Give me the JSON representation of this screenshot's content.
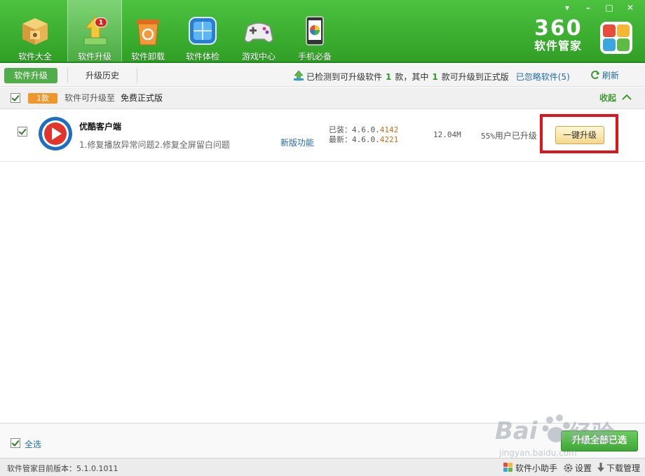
{
  "window": {
    "min": "▾",
    "restore": "–",
    "maximize": "□",
    "close": "✕"
  },
  "nav": [
    {
      "label": "软件大全",
      "icon": "box-icon"
    },
    {
      "label": "软件升级",
      "icon": "upgrade-arrow-icon",
      "badge": "1"
    },
    {
      "label": "软件卸载",
      "icon": "recycle-bin-icon"
    },
    {
      "label": "软件体检",
      "icon": "checkup-icon"
    },
    {
      "label": "游戏中心",
      "icon": "gamepad-icon"
    },
    {
      "label": "手机必备",
      "icon": "phone-icon"
    }
  ],
  "brand": {
    "name": "360",
    "sub": "软件管家"
  },
  "subbar": {
    "tab_active": "软件升级",
    "tab_history": "升级历史",
    "info_prefix": "已检测到可升级软件",
    "info_count1": "1",
    "info_mid": "款，其中",
    "info_count2": "1",
    "info_suffix": "款可升级到正式版",
    "ignored": "已忽略软件(5)",
    "refresh": "刷新"
  },
  "group": {
    "count": "1款",
    "text": "软件可升级至",
    "target": "免费正式版",
    "collapse": "收起"
  },
  "row": {
    "name": "优酷客户端",
    "desc": "1.修复播放异常问题2.修复全屏留白问题",
    "new_features": "新版功能",
    "installed_label": "已装：",
    "installed_prefix": "4.6.0.",
    "installed_suffix": "4142",
    "latest_label": "最新：",
    "latest_prefix": "4.6.0.",
    "latest_suffix": "4221",
    "size": "12.04M",
    "users_pct": "55%",
    "users_text": "用户已升级",
    "upgrade_btn": "一键升级"
  },
  "footer": {
    "select_all": "全选",
    "upgrade_all": "升级全部已选"
  },
  "status": {
    "version": "软件管家目前版本：5.1.0.1011",
    "helper": "软件小助手",
    "settings": "设置",
    "download": "下载管理"
  },
  "watermark": {
    "brand": "Bai",
    "jy": "经验",
    "url": "jingyan.baidu.com"
  },
  "colors": {
    "header_green": "#3fb333",
    "accent_blue": "#1f6bb5",
    "highlight_red": "#e0121a",
    "badge_orange": "#f0972c"
  }
}
